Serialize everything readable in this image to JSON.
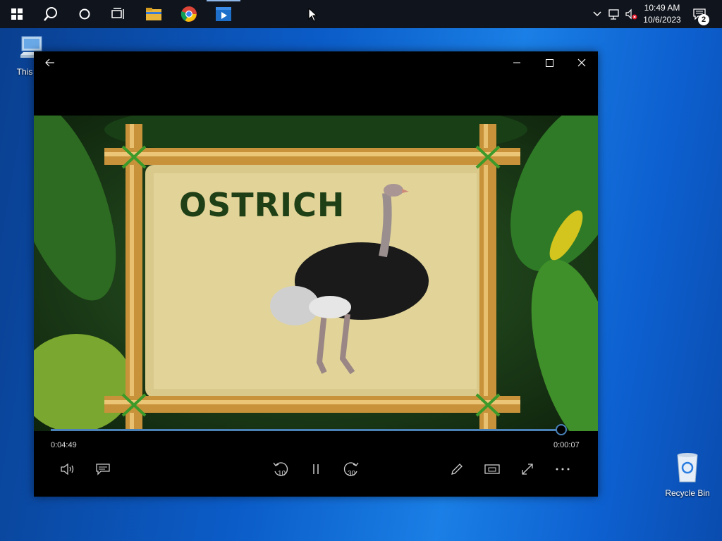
{
  "taskbar": {
    "clock_time": "10:49 AM",
    "clock_date": "10/6/2023",
    "notification_count": "2"
  },
  "desktop": {
    "icons": [
      {
        "label": "This PC"
      },
      {
        "label": "Recycle Bin"
      }
    ]
  },
  "player": {
    "video_title_text": "OSTRICH",
    "elapsed": "0:04:49",
    "remaining": "0:00:07",
    "skip_back_label": "10",
    "skip_forward_label": "30",
    "progress_fraction": 0.98
  },
  "colors": {
    "taskbar_bg": "#10141c",
    "progress": "#4a82b8",
    "title_text": "#1f3f16"
  }
}
